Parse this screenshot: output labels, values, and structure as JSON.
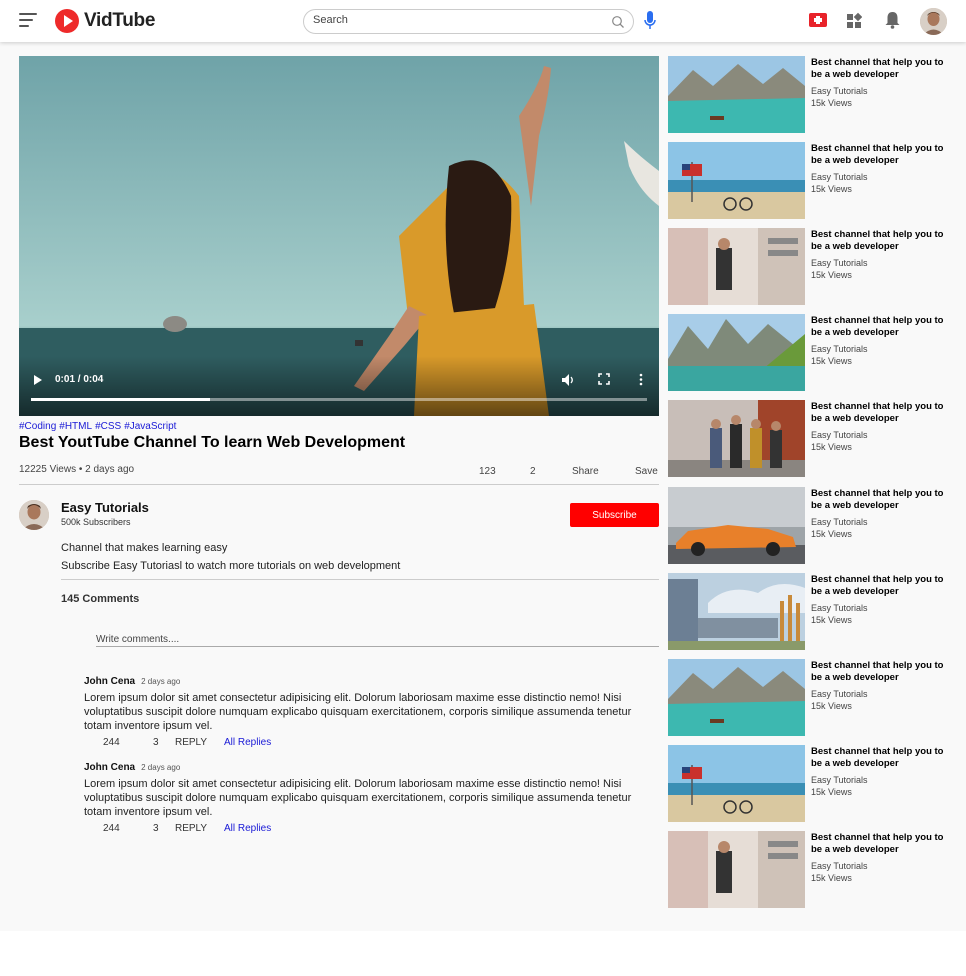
{
  "app": {
    "name": "VidTube",
    "brand_color": "#ee2a2a"
  },
  "search": {
    "placeholder": "Search"
  },
  "nav_icons": [
    "menu-icon",
    "mic-icon",
    "upload-icon",
    "apps-icon",
    "bell-icon",
    "avatar"
  ],
  "player": {
    "time": "0:01 / 0:04",
    "progress": 0.29
  },
  "video": {
    "tags": [
      "#Coding",
      "#HTML",
      "#CSS",
      "#JavaScript"
    ],
    "title": "Best YoutTube Channel To learn Web Development",
    "views": "12225 Views • 2 days ago",
    "likes": "123",
    "dislikes": "2",
    "share": "Share",
    "save": "Save"
  },
  "channel": {
    "name": "Easy Tutorials",
    "subscribers": "500k Subscribers",
    "subscribe_label": "Subscribe",
    "desc1": "Channel that makes learning easy",
    "desc2": "Subscribe Easy Tutoriasl to watch more tutorials on web development"
  },
  "comments": {
    "count": "145 Comments",
    "placeholder": "Write comments....",
    "items": [
      {
        "name": "John Cena",
        "time": "2 days ago",
        "text": "Lorem ipsum dolor sit amet consectetur adipisicing elit. Dolorum laboriosam maxime esse distinctio nemo! Nisi voluptatibus suscipit dolore numquam explicabo quisquam exercitationem, corporis similique assumenda tenetur totam inventore ipsum vel.",
        "likes": "244",
        "dislikes": "3",
        "reply": "REPLY",
        "all_replies": "All Replies"
      },
      {
        "name": "John Cena",
        "time": "2 days ago",
        "text": "Lorem ipsum dolor sit amet consectetur adipisicing elit. Dolorum laboriosam maxime esse distinctio nemo! Nisi voluptatibus suscipit dolore numquam explicabo quisquam exercitationem, corporis similique assumenda tenetur totam inventore ipsum vel.",
        "likes": "244",
        "dislikes": "3",
        "reply": "REPLY",
        "all_replies": "All Replies"
      }
    ]
  },
  "sidebar": {
    "items": [
      {
        "title": "Best channel that help you to be a web developer",
        "channel": "Easy Tutorials",
        "views": "15k Views",
        "thumb": "lake"
      },
      {
        "title": "Best channel that help you to be a web developer",
        "channel": "Easy Tutorials",
        "views": "15k Views",
        "thumb": "beach"
      },
      {
        "title": "Best channel that help you to be a web developer",
        "channel": "Easy Tutorials",
        "views": "15k Views",
        "thumb": "street"
      },
      {
        "title": "Best channel that help you to be a web developer",
        "channel": "Easy Tutorials",
        "views": "15k Views",
        "thumb": "mountain"
      },
      {
        "title": "Best channel that help you to be a web developer",
        "channel": "Easy Tutorials",
        "views": "15k Views",
        "thumb": "people"
      },
      {
        "title": "Best channel that help you to be a web developer",
        "channel": "Easy Tutorials",
        "views": "15k Views",
        "thumb": "car"
      },
      {
        "title": "Best channel that help you to be a web developer",
        "channel": "Easy Tutorials",
        "views": "15k Views",
        "thumb": "building"
      },
      {
        "title": "Best channel that help you to be a web developer",
        "channel": "Easy Tutorials",
        "views": "15k Views",
        "thumb": "lake"
      },
      {
        "title": "Best channel that help you to be a web developer",
        "channel": "Easy Tutorials",
        "views": "15k Views",
        "thumb": "beach"
      },
      {
        "title": "Best channel that help you to be a web developer",
        "channel": "Easy Tutorials",
        "views": "15k Views",
        "thumb": "street"
      }
    ]
  }
}
